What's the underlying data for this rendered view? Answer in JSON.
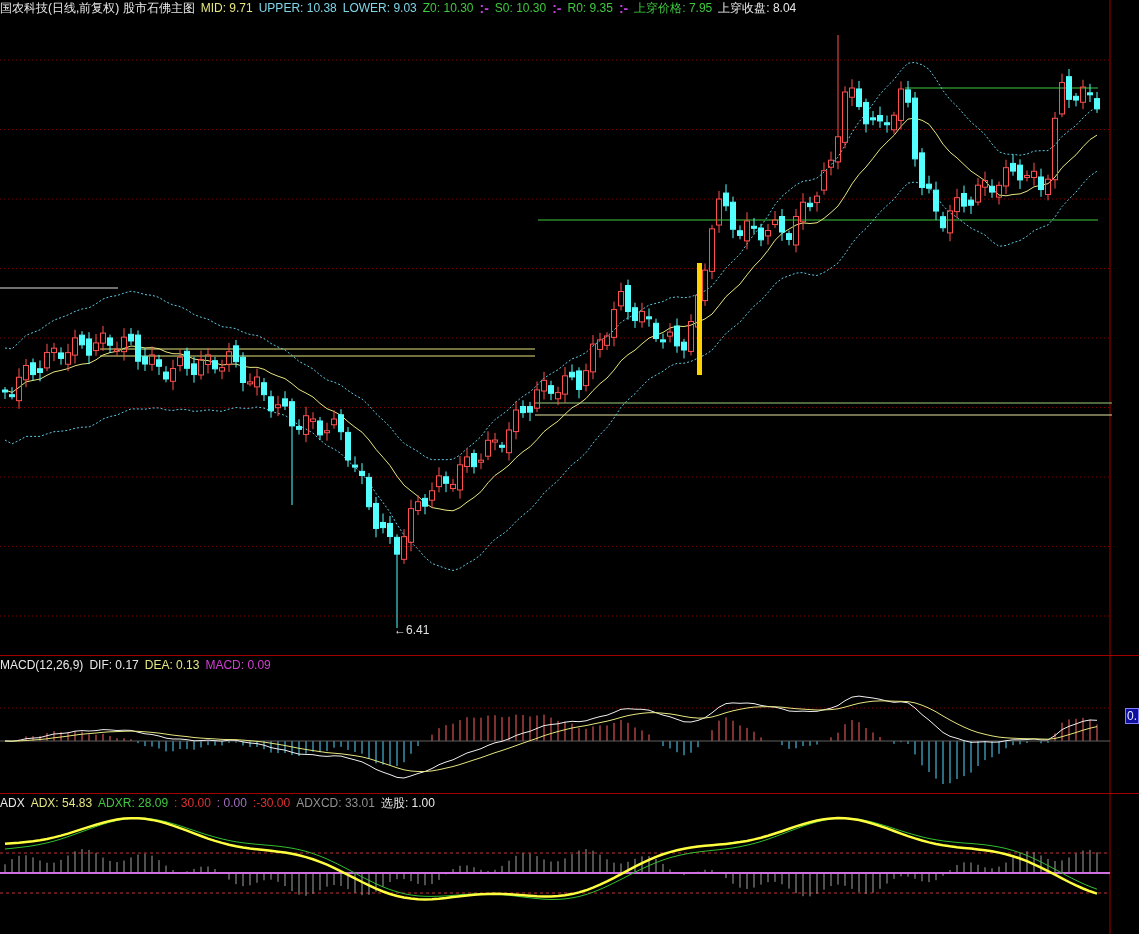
{
  "main_panel": {
    "legend": [
      {
        "text": "国农科技(日线,前复权) 股市石佛主图",
        "color": "#e8e8e8"
      },
      {
        "text": "MID: 9.71",
        "color": "#e6e680"
      },
      {
        "text": "UPPER: 10.38",
        "color": "#7fd6e8"
      },
      {
        "text": "LOWER: 9.03",
        "color": "#7fd6e8"
      },
      {
        "text": "Z0: 10.30",
        "color": "#3fc83f"
      },
      {
        "text": ":-",
        "color": "#c040e0",
        "kind": "separator"
      },
      {
        "text": "S0: 10.30",
        "color": "#3fc83f"
      },
      {
        "text": ":-",
        "color": "#c040e0",
        "kind": "separator"
      },
      {
        "text": "R0: 9.35",
        "color": "#3fc83f"
      },
      {
        "text": ":-",
        "color": "#c040e0",
        "kind": "separator"
      },
      {
        "text": "上穿价格: 7.95",
        "color": "#3fc83f"
      },
      {
        "text": "上穿收盘: 8.04",
        "color": "#e8e8e8"
      }
    ],
    "low_label": "←6.41"
  },
  "macd_panel": {
    "legend": [
      {
        "text": "MACD(12,26,9)",
        "color": "#e8e8e8"
      },
      {
        "text": "DIF: 0.17",
        "color": "#e8e8e8"
      },
      {
        "text": "DEA: 0.13",
        "color": "#e6e680"
      },
      {
        "text": "MACD: 0.09",
        "color": "#d040d0"
      }
    ],
    "axis_label": "0."
  },
  "adx_panel": {
    "legend": [
      {
        "text": "ADX",
        "color": "#e8e8e8"
      },
      {
        "text": "ADX: 54.83",
        "color": "#e6e680"
      },
      {
        "text": "ADXR: 28.09",
        "color": "#3fc83f"
      },
      {
        "text": ": 30.00",
        "color": "#e03030"
      },
      {
        "text": ": 0.00",
        "color": "#a070c0"
      },
      {
        "text": ":-30.00",
        "color": "#e03030"
      },
      {
        "text": "ADXCD: 33.01",
        "color": "#909090"
      },
      {
        "text": "选股: 1.00",
        "color": "#e8e8e8"
      }
    ]
  }
}
